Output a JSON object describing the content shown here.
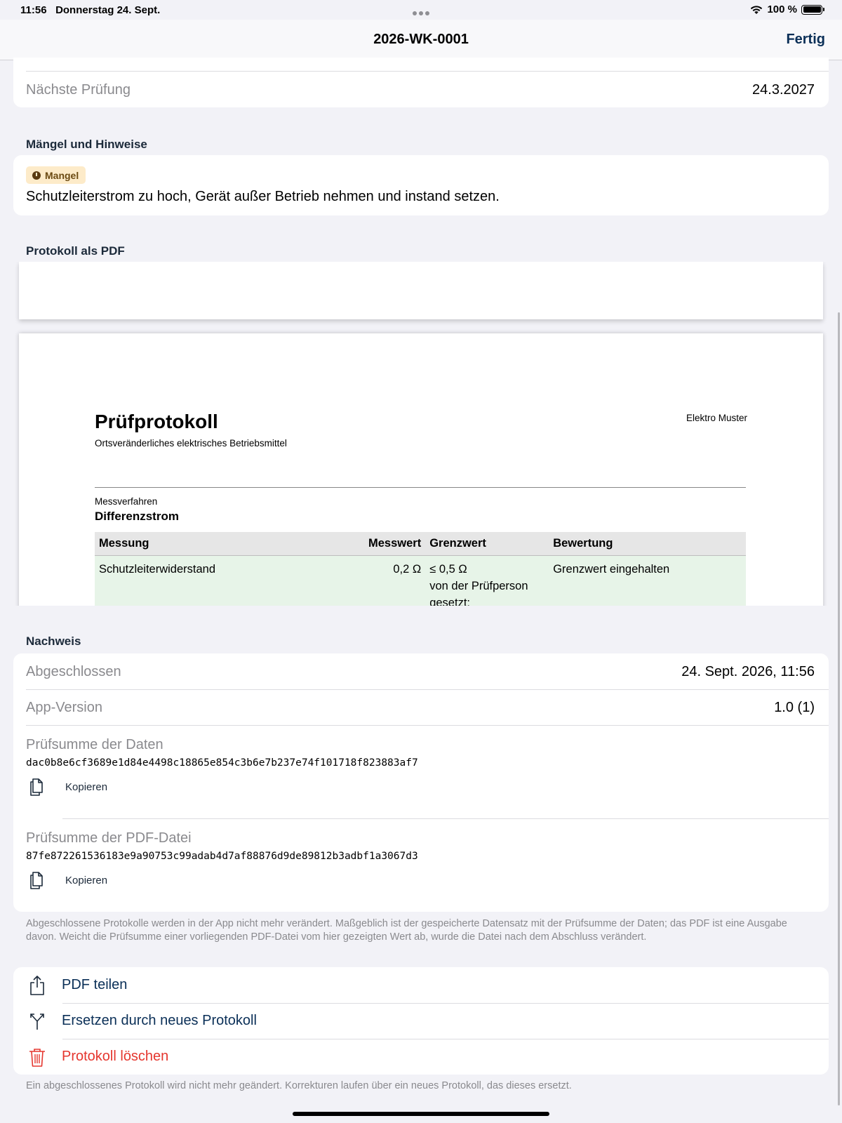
{
  "status_bar": {
    "time": "11:56",
    "date": "Donnerstag 24. Sept.",
    "battery": "100 %"
  },
  "nav": {
    "title": "2026-WK-0001",
    "done": "Fertig"
  },
  "info_card": {
    "next_test_label": "Nächste Prüfung",
    "next_test_value": "24.3.2027"
  },
  "defects": {
    "header": "Mängel und Hinweise",
    "badge": "Mangel",
    "text": "Schutzleiterstrom zu hoch, Gerät außer Betrieb nehmen und instand setzen."
  },
  "pdf": {
    "header": "Protokoll als PDF",
    "title": "Prüfprotokoll",
    "subtitle": "Ortsveränderliches elektrisches Betriebsmittel",
    "company": "Elektro Muster",
    "method_label": "Messverfahren",
    "method": "Differenzstrom",
    "table": {
      "headers": [
        "Messung",
        "Messwert",
        "Grenzwert",
        "Bewertung"
      ],
      "rows": [
        {
          "measurement": "Schutzleiterwiderstand",
          "value": "0,2 Ω",
          "limit": "≤ 0,5 Ω",
          "limit_note": "von der Prüfperson",
          "limit_note2": "gesetzt:",
          "rating": "Grenzwert eingehalten"
        }
      ]
    }
  },
  "proof": {
    "header": "Nachweis",
    "completed_label": "Abgeschlossen",
    "completed_value": "24. Sept. 2026, 11:56",
    "version_label": "App-Version",
    "version_value": "1.0 (1)",
    "data_hash_label": "Prüfsumme der Daten",
    "data_hash": "dac0b8e6cf3689e1d84e4498c18865e854c3b6e7b237e74f101718f823883af7",
    "pdf_hash_label": "Prüfsumme der PDF-Datei",
    "pdf_hash": "87fe872261536183e9a90753c99adab4d7af88876d9de89812b3adbf1a3067d3",
    "copy_label": "Kopieren",
    "footnote": "Abgeschlossene Protokolle werden in der App nicht mehr verändert. Maßgeblich ist der gespeicherte Datensatz mit der Prüfsumme der Daten; das PDF ist eine Ausgabe davon. Weicht die Prüfsumme einer vorliegenden PDF-Datei vom hier gezeigten Wert ab, wurde die Datei nach dem Abschluss verändert."
  },
  "actions": {
    "share": "PDF teilen",
    "replace": "Ersetzen durch neues Protokoll",
    "delete": "Protokoll löschen",
    "footnote": "Ein abgeschlossenes Protokoll wird nicht mehr geändert. Korrekturen laufen über ein neues Protokoll, das dieses ersetzt."
  },
  "colors": {
    "accent": "#0a2f57",
    "danger": "#e5362e",
    "badge_bg": "#fdebc9",
    "pass_row": "#e7f4e8"
  },
  "icons": [
    "wifi-icon",
    "battery-icon",
    "warning-icon",
    "copy-icon",
    "share-icon",
    "branch-icon",
    "trash-icon"
  ]
}
